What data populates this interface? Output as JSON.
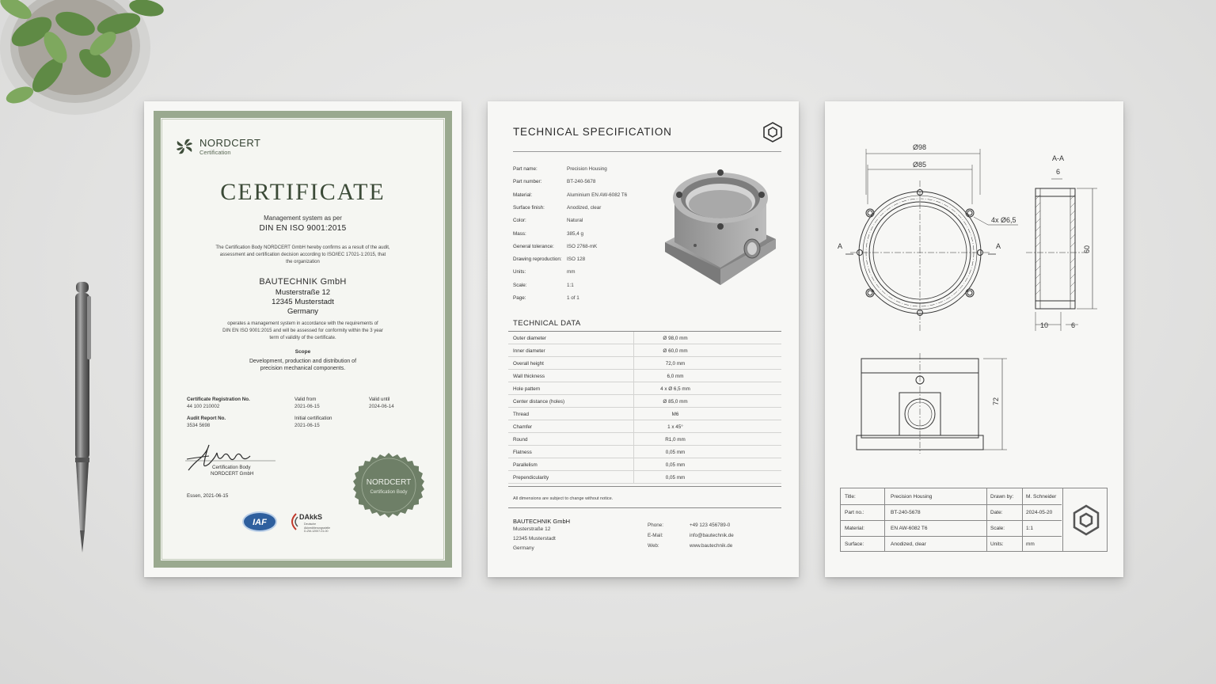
{
  "certificate": {
    "brand_name": "NORDCERT",
    "brand_sub": "Certification",
    "title": "CERTIFICATE",
    "subtitle1": "Management system as per",
    "standard": "DIN EN ISO 9001:2015",
    "intro1": "The Certification Body NORDCERT GmbH hereby confirms as a result of the audit,",
    "intro2": "assessment and certification decision according to ISO/IEC 17021-1:2015, that",
    "intro3": "the organization",
    "company": "BAUTECHNIK GmbH",
    "street": "Musterstraße 12",
    "city": "12345 Musterstadt",
    "country": "Germany",
    "body1": "operates a management system in accordance with the requirements of",
    "body2": "DIN EN ISO 9001:2015 and will be assessed for conformity within the 3 year",
    "body3": "term of validity of the certificate.",
    "scope_label": "Scope",
    "scope1": "Development, production and distribution of",
    "scope2": "precision mechanical components.",
    "reg_label": "Certificate Registration No.",
    "reg_value": "44 100 210002",
    "valid_from_label": "Valid from",
    "valid_from_value": "2021-06-15",
    "valid_until_label": "Valid until",
    "valid_until_value": "2024-06-14",
    "audit_label": "Audit Report No.",
    "audit_value": "3534 5698",
    "initial_label": "Initial certification",
    "initial_value": "2021-06-15",
    "sig_line1": "Certification Body",
    "sig_line2": "NORDCERT GmbH",
    "place_date": "Essen, 2021-06-15",
    "seal_title": "NORDCERT",
    "seal_sub": "Certification Body",
    "iaf": "IAF",
    "dakks": "DAkkS",
    "dakks_sub1": "Deutsche",
    "dakks_sub2": "Akkreditierungsstelle",
    "dakks_sub3": "D-ZM-12007-01-00"
  },
  "spec": {
    "title": "TECHNICAL SPECIFICATION",
    "props": [
      {
        "label": "Part name:",
        "value": "Precision Housing"
      },
      {
        "label": "Part number:",
        "value": "BT-240-5678"
      },
      {
        "label": "Material:",
        "value": "Aluminium EN AW-6082 T6"
      },
      {
        "label": "Surface finish:",
        "value": "Anodized, clear"
      },
      {
        "label": "Color:",
        "value": "Natural"
      },
      {
        "label": "Mass:",
        "value": "385,4 g"
      },
      {
        "label": "General tolerance:",
        "value": "ISO 2768-mK"
      },
      {
        "label": "Drawing reproduction:",
        "value": "ISO 128"
      },
      {
        "label": "Units:",
        "value": "mm"
      },
      {
        "label": "Scale:",
        "value": "1:1"
      },
      {
        "label": "Page:",
        "value": "1 of 1"
      }
    ],
    "data_title": "TECHNICAL DATA",
    "data_rows": [
      {
        "label": "Outer diameter",
        "value": "Ø 98,0 mm"
      },
      {
        "label": "Inner diameter",
        "value": "Ø 60,0 mm"
      },
      {
        "label": "Overall height",
        "value": "72,0 mm"
      },
      {
        "label": "Wall thickness",
        "value": "6,0 mm"
      },
      {
        "label": "Hole pattern",
        "value": "4 x Ø 6,5 mm"
      },
      {
        "label": "Center distance (holes)",
        "value": "Ø 85,0 mm"
      },
      {
        "label": "Thread",
        "value": "M6"
      },
      {
        "label": "Chamfer",
        "value": "1 x 45°"
      },
      {
        "label": "Round",
        "value": "R1,0 mm"
      },
      {
        "label": "Flatness",
        "value": "0,05 mm"
      },
      {
        "label": "Parallelism",
        "value": "0,05 mm"
      },
      {
        "label": "Prependicularity",
        "value": "0,05 mm"
      }
    ],
    "note": "All dimensions are subject to change without notice.",
    "company": "BAUTECHNIK GmbH",
    "street": "Musterstraße 12",
    "city": "12345 Musterstadt",
    "country": "Germany",
    "phone_label": "Phone:",
    "phone": "+49 123 456789-0",
    "email_label": "E-Mail:",
    "email": "info@bautechnik.de",
    "web_label": "Web:",
    "web": "www.bautechnik.de"
  },
  "drawing": {
    "dim_98": "Ø98",
    "dim_85": "Ø85",
    "holes": "4x Ø6,5",
    "sec_a": "A",
    "section": "A-A",
    "dim_6a": "6",
    "dim_60": "60",
    "dim_10": "10",
    "dim_6b": "6",
    "dim_72": "72",
    "tb": {
      "title_label": "Title:",
      "title": "Precision Housing",
      "drawn_label": "Drawn by:",
      "drawn": "M. Schneider",
      "part_label": "Part no.:",
      "part": "BT-240-5678",
      "date_label": "Date:",
      "date": "2024-05-20",
      "material_label": "Material:",
      "material": "EN AW-6082 T6",
      "scale_label": "Scale:",
      "scale": "1:1",
      "surface_label": "Surface:",
      "surface": "Anodized, clear",
      "units_label": "Units:",
      "units": "mm"
    }
  }
}
